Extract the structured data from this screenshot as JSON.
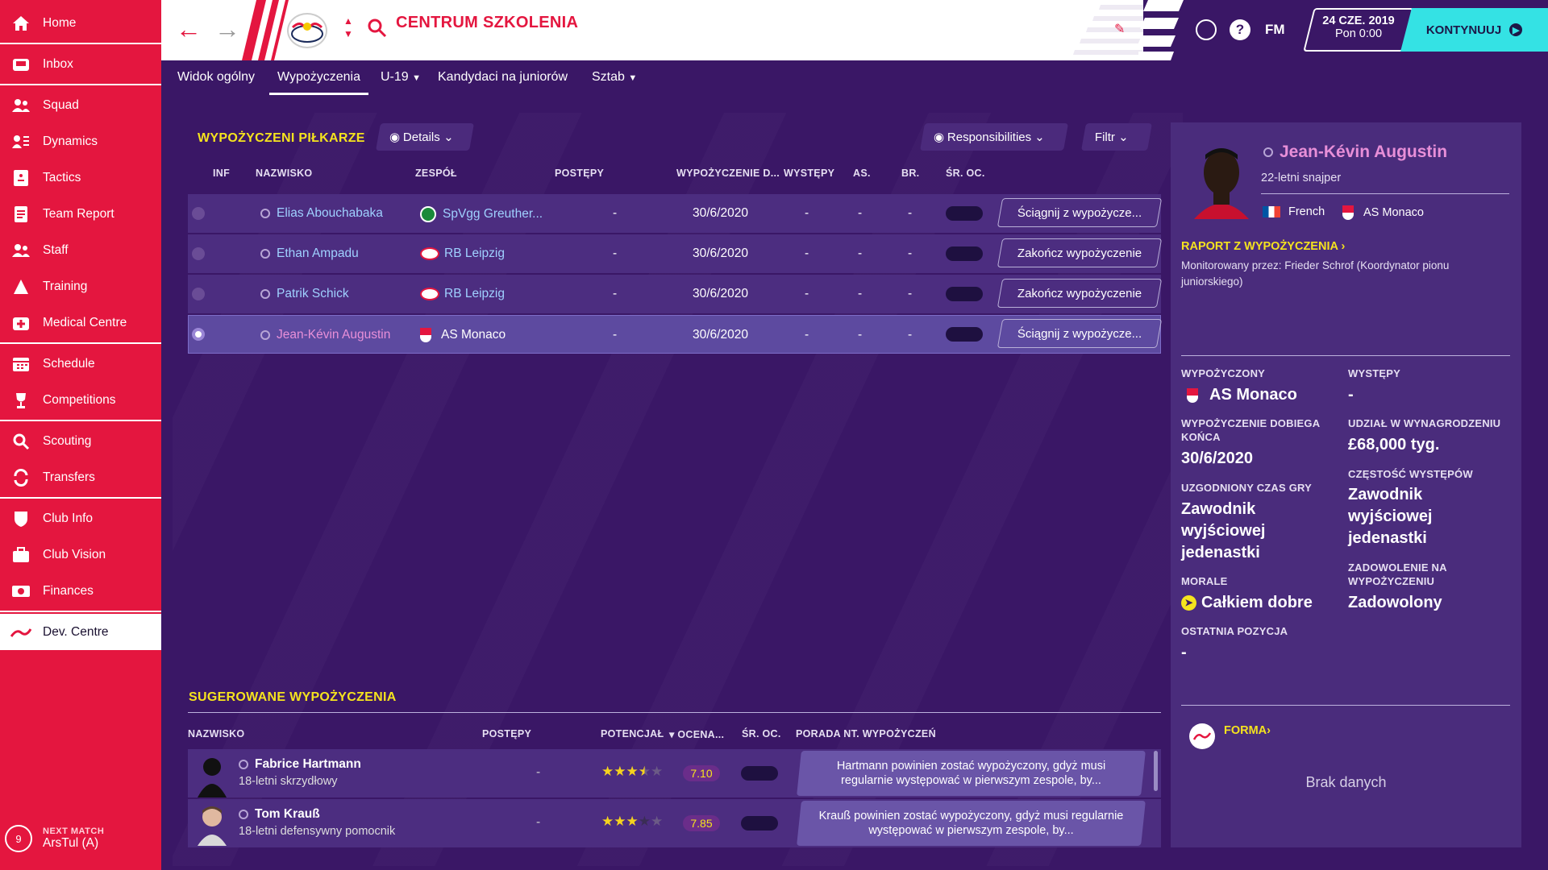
{
  "sidebar": {
    "items": [
      {
        "label": "Home",
        "icon": "home-icon"
      },
      {
        "label": "Inbox",
        "icon": "inbox-icon"
      },
      {
        "label": "Squad",
        "icon": "squad-icon"
      },
      {
        "label": "Dynamics",
        "icon": "dynamics-icon"
      },
      {
        "label": "Tactics",
        "icon": "tactics-icon"
      },
      {
        "label": "Team Report",
        "icon": "report-icon"
      },
      {
        "label": "Staff",
        "icon": "staff-icon"
      },
      {
        "label": "Training",
        "icon": "training-icon"
      },
      {
        "label": "Medical Centre",
        "icon": "medical-icon"
      },
      {
        "label": "Schedule",
        "icon": "calendar-icon"
      },
      {
        "label": "Competitions",
        "icon": "trophy-icon"
      },
      {
        "label": "Scouting",
        "icon": "magnifier-icon"
      },
      {
        "label": "Transfers",
        "icon": "transfer-icon"
      },
      {
        "label": "Club Info",
        "icon": "shield-icon"
      },
      {
        "label": "Club Vision",
        "icon": "briefcase-icon"
      },
      {
        "label": "Finances",
        "icon": "money-icon"
      },
      {
        "label": "Dev. Centre",
        "icon": "dev-centre-icon"
      }
    ],
    "next_match": {
      "label": "NEXT MATCH",
      "opponent": "ArsTul (A)",
      "days": "9"
    }
  },
  "header": {
    "title": "CENTRUM SZKOLENIA",
    "date": "24 CZE. 2019",
    "time": "Pon 0:00",
    "continue": "KONTYNUUJ",
    "fm": "FM",
    "help": "?"
  },
  "tabs": [
    "Widok ogólny",
    "Wypożyczenia",
    "U-19",
    "Kandydaci na juniorów",
    "Sztab"
  ],
  "loans": {
    "title": "WYPOŻYCZENI PIŁKARZE",
    "view_btn": "Details",
    "resp_btn": "Responsibilities",
    "filter_btn": "Filtr",
    "columns": [
      "INF",
      "NAZWISKO",
      "ZESPÓŁ",
      "POSTĘPY",
      "WYPOŻYCZENIE D...",
      "WYSTĘPY",
      "AS.",
      "BR.",
      "ŚR. OC."
    ],
    "rows": [
      {
        "name": "Elias Abouchabaka",
        "team": "SpVgg Greuther...",
        "progress": "-",
        "end": "30/6/2020",
        "apps": "-",
        "ast": "-",
        "goals": "-",
        "action": "Ściągnij z wypożycze..."
      },
      {
        "name": "Ethan Ampadu",
        "team": "RB Leipzig",
        "progress": "-",
        "end": "30/6/2020",
        "apps": "-",
        "ast": "-",
        "goals": "-",
        "action": "Zakończ wypożyczenie"
      },
      {
        "name": "Patrik Schick",
        "team": "RB Leipzig",
        "progress": "-",
        "end": "30/6/2020",
        "apps": "-",
        "ast": "-",
        "goals": "-",
        "action": "Zakończ wypożyczenie"
      },
      {
        "name": "Jean-Kévin Augustin",
        "team": "AS Monaco",
        "progress": "-",
        "end": "30/6/2020",
        "apps": "-",
        "ast": "-",
        "goals": "-",
        "action": "Ściągnij z wypożycze..."
      }
    ],
    "rating_placeholder": "-"
  },
  "suggested": {
    "title": "SUGEROWANE WYPOŻYCZENIA",
    "columns": [
      "NAZWISKO",
      "POSTĘPY",
      "POTENCJAŁ",
      "OCENA...",
      "ŚR. OC.",
      "PORADA NT. WYPOŻYCZEŃ"
    ],
    "rows": [
      {
        "name": "Fabrice Hartmann",
        "desc": "18-letni skrzydłowy",
        "progress": "-",
        "stars": 3.5,
        "ocena": "7.10",
        "rating": "-",
        "advice": "Hartmann powinien zostać wypożyczony, gdyż musi regularnie występować w pierwszym zespole, by..."
      },
      {
        "name": "Tom Krauß",
        "desc": "18-letni defensywny pomocnik",
        "progress": "-",
        "stars": 3,
        "ocena": "7.85",
        "rating": "-",
        "advice": "Krauß powinien zostać wypożyczony, gdyż musi regularnie występować w pierwszym zespole, by..."
      }
    ]
  },
  "player": {
    "name": "Jean-Kévin Augustin",
    "desc": "22-letni snajper",
    "nationality": "French",
    "club": "AS Monaco",
    "report_link": "RAPORT Z WYPOŻYCZENIA",
    "monitored": "Monitorowany przez: Frieder Schrof (Koordynator pionu juniorskiego)",
    "loaned_label": "WYPOŻYCZONY",
    "loaned_val": "AS Monaco",
    "apps_label": "WYSTĘPY",
    "apps_val": "-",
    "end_label": "WYPOŻYCZENIE DOBIEGA KOŃCA",
    "end_val": "30/6/2020",
    "wage_label": "UDZIAŁ W WYNAGRODZENIU",
    "wage_val": "£68,000 tyg.",
    "time_label": "UZGODNIONY CZAS GRY",
    "time_val": "Zawodnik wyjściowej jedenastki",
    "freq_label": "CZĘSTOŚĆ WYSTĘPÓW",
    "freq_val": "Zawodnik wyjściowej jedenastki",
    "morale_label": "MORALE",
    "morale_val": "Całkiem dobre",
    "satisf_label": "ZADOWOLENIE NA WYPOŻYCZENIU",
    "satisf_val": "Zadowolony",
    "lastpos_label": "OSTATNIA POZYCJA",
    "lastpos_val": "-",
    "form_link": "FORMA",
    "no_data": "Brak danych"
  },
  "colors": {
    "accent": "#e4163f",
    "bg": "#3a1766",
    "highlight": "#f5e31e",
    "continue": "#34e2e4"
  }
}
